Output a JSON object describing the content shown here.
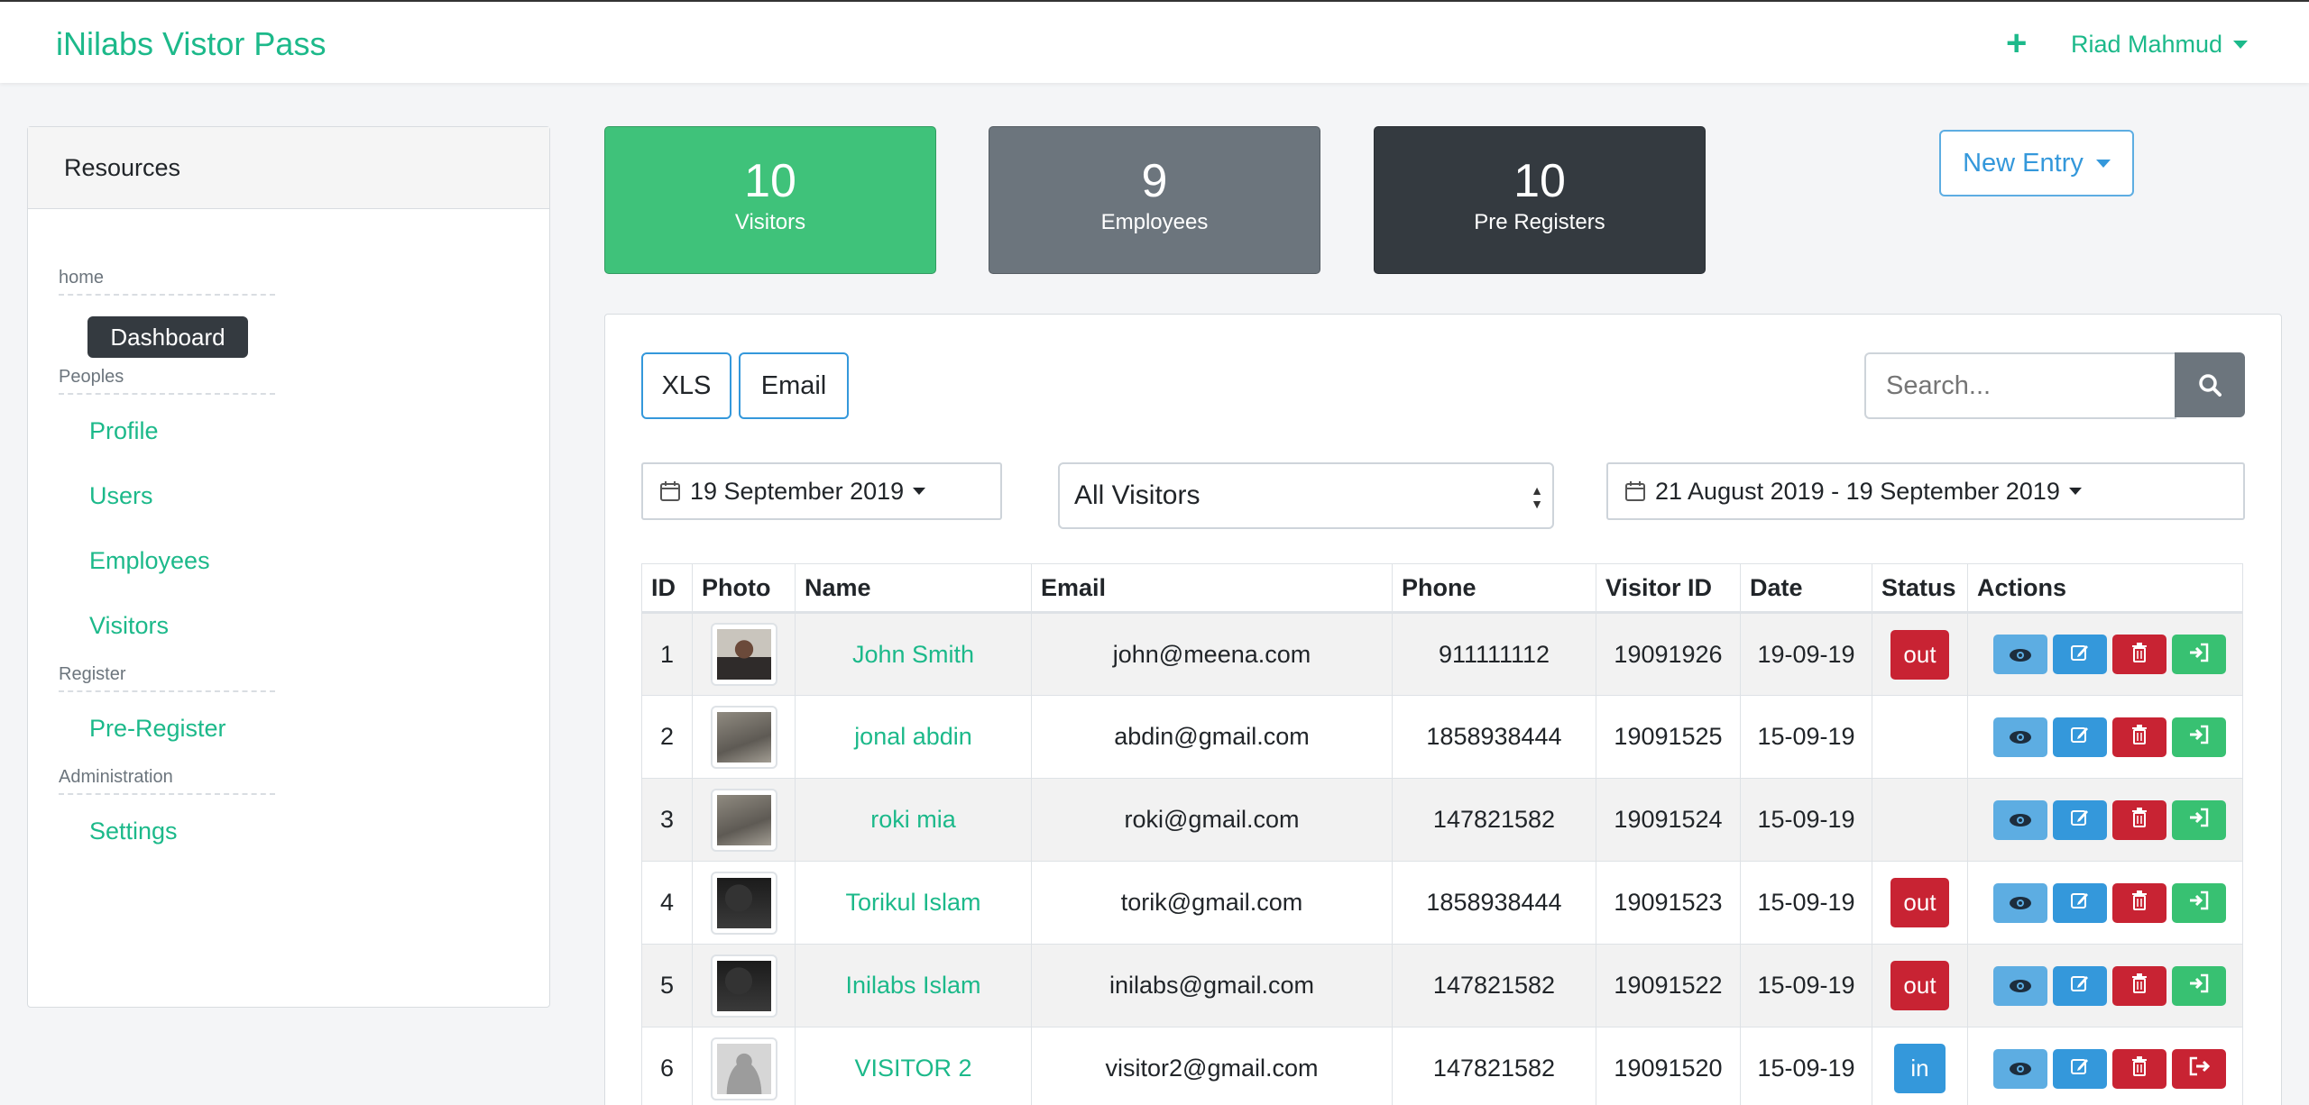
{
  "brand": "iNilabs Vistor Pass",
  "header": {
    "plus_icon": "plus-icon",
    "user_name": "Riad Mahmud"
  },
  "sidebar": {
    "title": "Resources",
    "sections": [
      {
        "label": "home",
        "items": [
          "Dashboard"
        ]
      },
      {
        "label": "Peoples",
        "items": [
          "Profile",
          "Users",
          "Employees",
          "Visitors"
        ]
      },
      {
        "label": "Register",
        "items": [
          "Pre-Register"
        ]
      },
      {
        "label": "Administration",
        "items": [
          "Settings"
        ]
      }
    ],
    "active": "Dashboard"
  },
  "cards": [
    {
      "value": "10",
      "label": "Visitors",
      "color": "#3fc27a"
    },
    {
      "value": "9",
      "label": "Employees",
      "color": "#6c757d"
    },
    {
      "value": "10",
      "label": "Pre Registers",
      "color": "#343a40"
    }
  ],
  "new_entry": "New Entry",
  "toolbar": {
    "xls": "XLS",
    "email": "Email",
    "search_placeholder": "Search..."
  },
  "filters": {
    "date": "19 September 2019",
    "visitor_type": "All Visitors",
    "date_range": "21 August 2019 - 19 September 2019"
  },
  "table": {
    "columns": [
      "ID",
      "Photo",
      "Name",
      "Email",
      "Phone",
      "Visitor ID",
      "Date",
      "Status",
      "Actions"
    ],
    "rows": [
      {
        "id": "1",
        "name": "John Smith",
        "email": "john@meena.com",
        "phone": "911111112",
        "visitor_id": "19091926",
        "date": "19-09-19",
        "status": "out"
      },
      {
        "id": "2",
        "name": "jonal abdin",
        "email": "abdin@gmail.com",
        "phone": "1858938444",
        "visitor_id": "19091525",
        "date": "15-09-19",
        "status": ""
      },
      {
        "id": "3",
        "name": "roki mia",
        "email": "roki@gmail.com",
        "phone": "147821582",
        "visitor_id": "19091524",
        "date": "15-09-19",
        "status": ""
      },
      {
        "id": "4",
        "name": "Torikul Islam",
        "email": "torik@gmail.com",
        "phone": "1858938444",
        "visitor_id": "19091523",
        "date": "15-09-19",
        "status": "out"
      },
      {
        "id": "5",
        "name": "Inilabs Islam",
        "email": "inilabs@gmail.com",
        "phone": "147821582",
        "visitor_id": "19091522",
        "date": "15-09-19",
        "status": "out"
      },
      {
        "id": "6",
        "name": "VISITOR 2",
        "email": "visitor2@gmail.com",
        "phone": "147821582",
        "visitor_id": "19091520",
        "date": "15-09-19",
        "status": "in"
      }
    ]
  }
}
